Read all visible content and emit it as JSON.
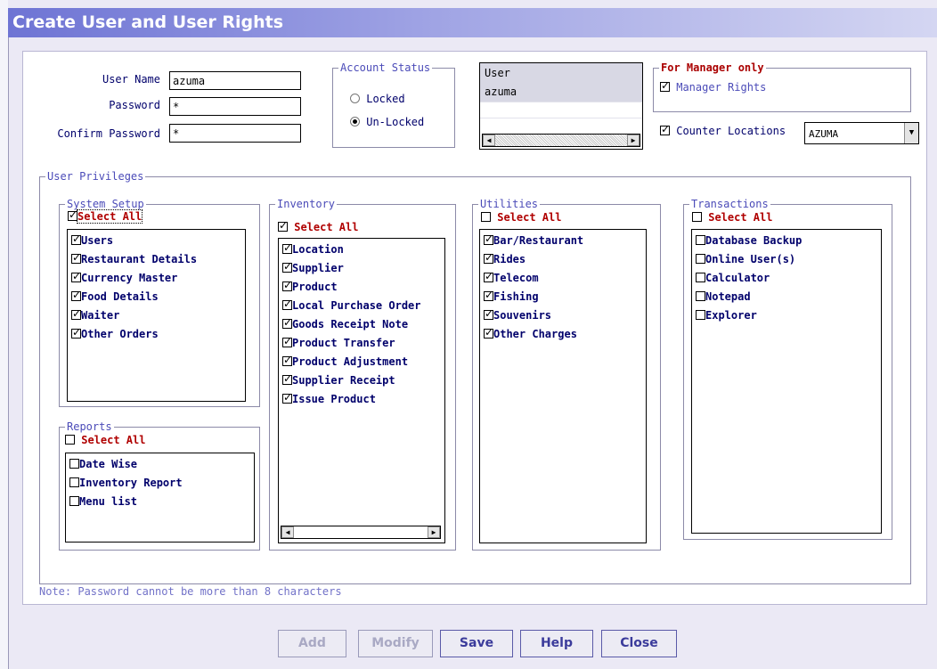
{
  "window": {
    "title": "Create User and User Rights"
  },
  "login": {
    "username_label": "User Name",
    "username_value": "azuma",
    "password_label": "Password",
    "password_value": "*",
    "confirm_label": "Confirm Password",
    "confirm_value": "*"
  },
  "account_status": {
    "legend": "Account Status",
    "locked_label": "Locked",
    "unlocked_label": "Un-Locked",
    "selected": "Un-Locked"
  },
  "user_list": {
    "header": "User",
    "rows": [
      "azuma"
    ]
  },
  "manager": {
    "legend": "For Manager only",
    "rights_label": "Manager Rights",
    "rights_checked": true,
    "counter_label": "Counter Locations",
    "counter_checked": true,
    "counter_value": "AZUMA"
  },
  "privileges": {
    "legend": "User Privileges",
    "select_all": "Select All",
    "system_setup": {
      "legend": "System Setup",
      "all_checked": true,
      "items": [
        "Users",
        "Restaurant Details",
        "Currency Master",
        "Food Details",
        "Waiter",
        "Other Orders"
      ],
      "checked": [
        true,
        true,
        true,
        true,
        true,
        true
      ]
    },
    "reports": {
      "legend": "Reports",
      "all_checked": false,
      "items": [
        "Date Wise",
        "Inventory Report",
        "Menu list"
      ],
      "checked": [
        false,
        false,
        false
      ]
    },
    "inventory": {
      "legend": "Inventory",
      "all_checked": true,
      "items": [
        "Location",
        "Supplier",
        "Product",
        "Local Purchase Order",
        "Goods Receipt Note",
        "Product Transfer",
        "Product Adjustment",
        "Supplier Receipt",
        "Issue Product"
      ],
      "checked": [
        true,
        true,
        true,
        true,
        true,
        true,
        true,
        true,
        true
      ]
    },
    "utilities": {
      "legend": "Utilities",
      "all_checked": false,
      "items": [
        "Bar/Restaurant",
        "Rides",
        "Telecom",
        "Fishing",
        "Souvenirs",
        "Other Charges"
      ],
      "checked": [
        true,
        true,
        true,
        true,
        true,
        true
      ]
    },
    "transactions": {
      "legend": "Transactions",
      "all_checked": false,
      "items": [
        "Database Backup",
        "Online User(s)",
        "Calculator",
        "Notepad",
        "Explorer"
      ],
      "checked": [
        false,
        false,
        false,
        false,
        false
      ]
    }
  },
  "note": "Note: Password cannot be more than 8 characters",
  "buttons": {
    "add": {
      "label": "Add",
      "enabled": false
    },
    "modify": {
      "label": "Modify",
      "enabled": false
    },
    "save": {
      "label": "Save",
      "enabled": true
    },
    "help": {
      "label": "Help",
      "enabled": true
    },
    "close": {
      "label": "Close",
      "enabled": true
    }
  }
}
